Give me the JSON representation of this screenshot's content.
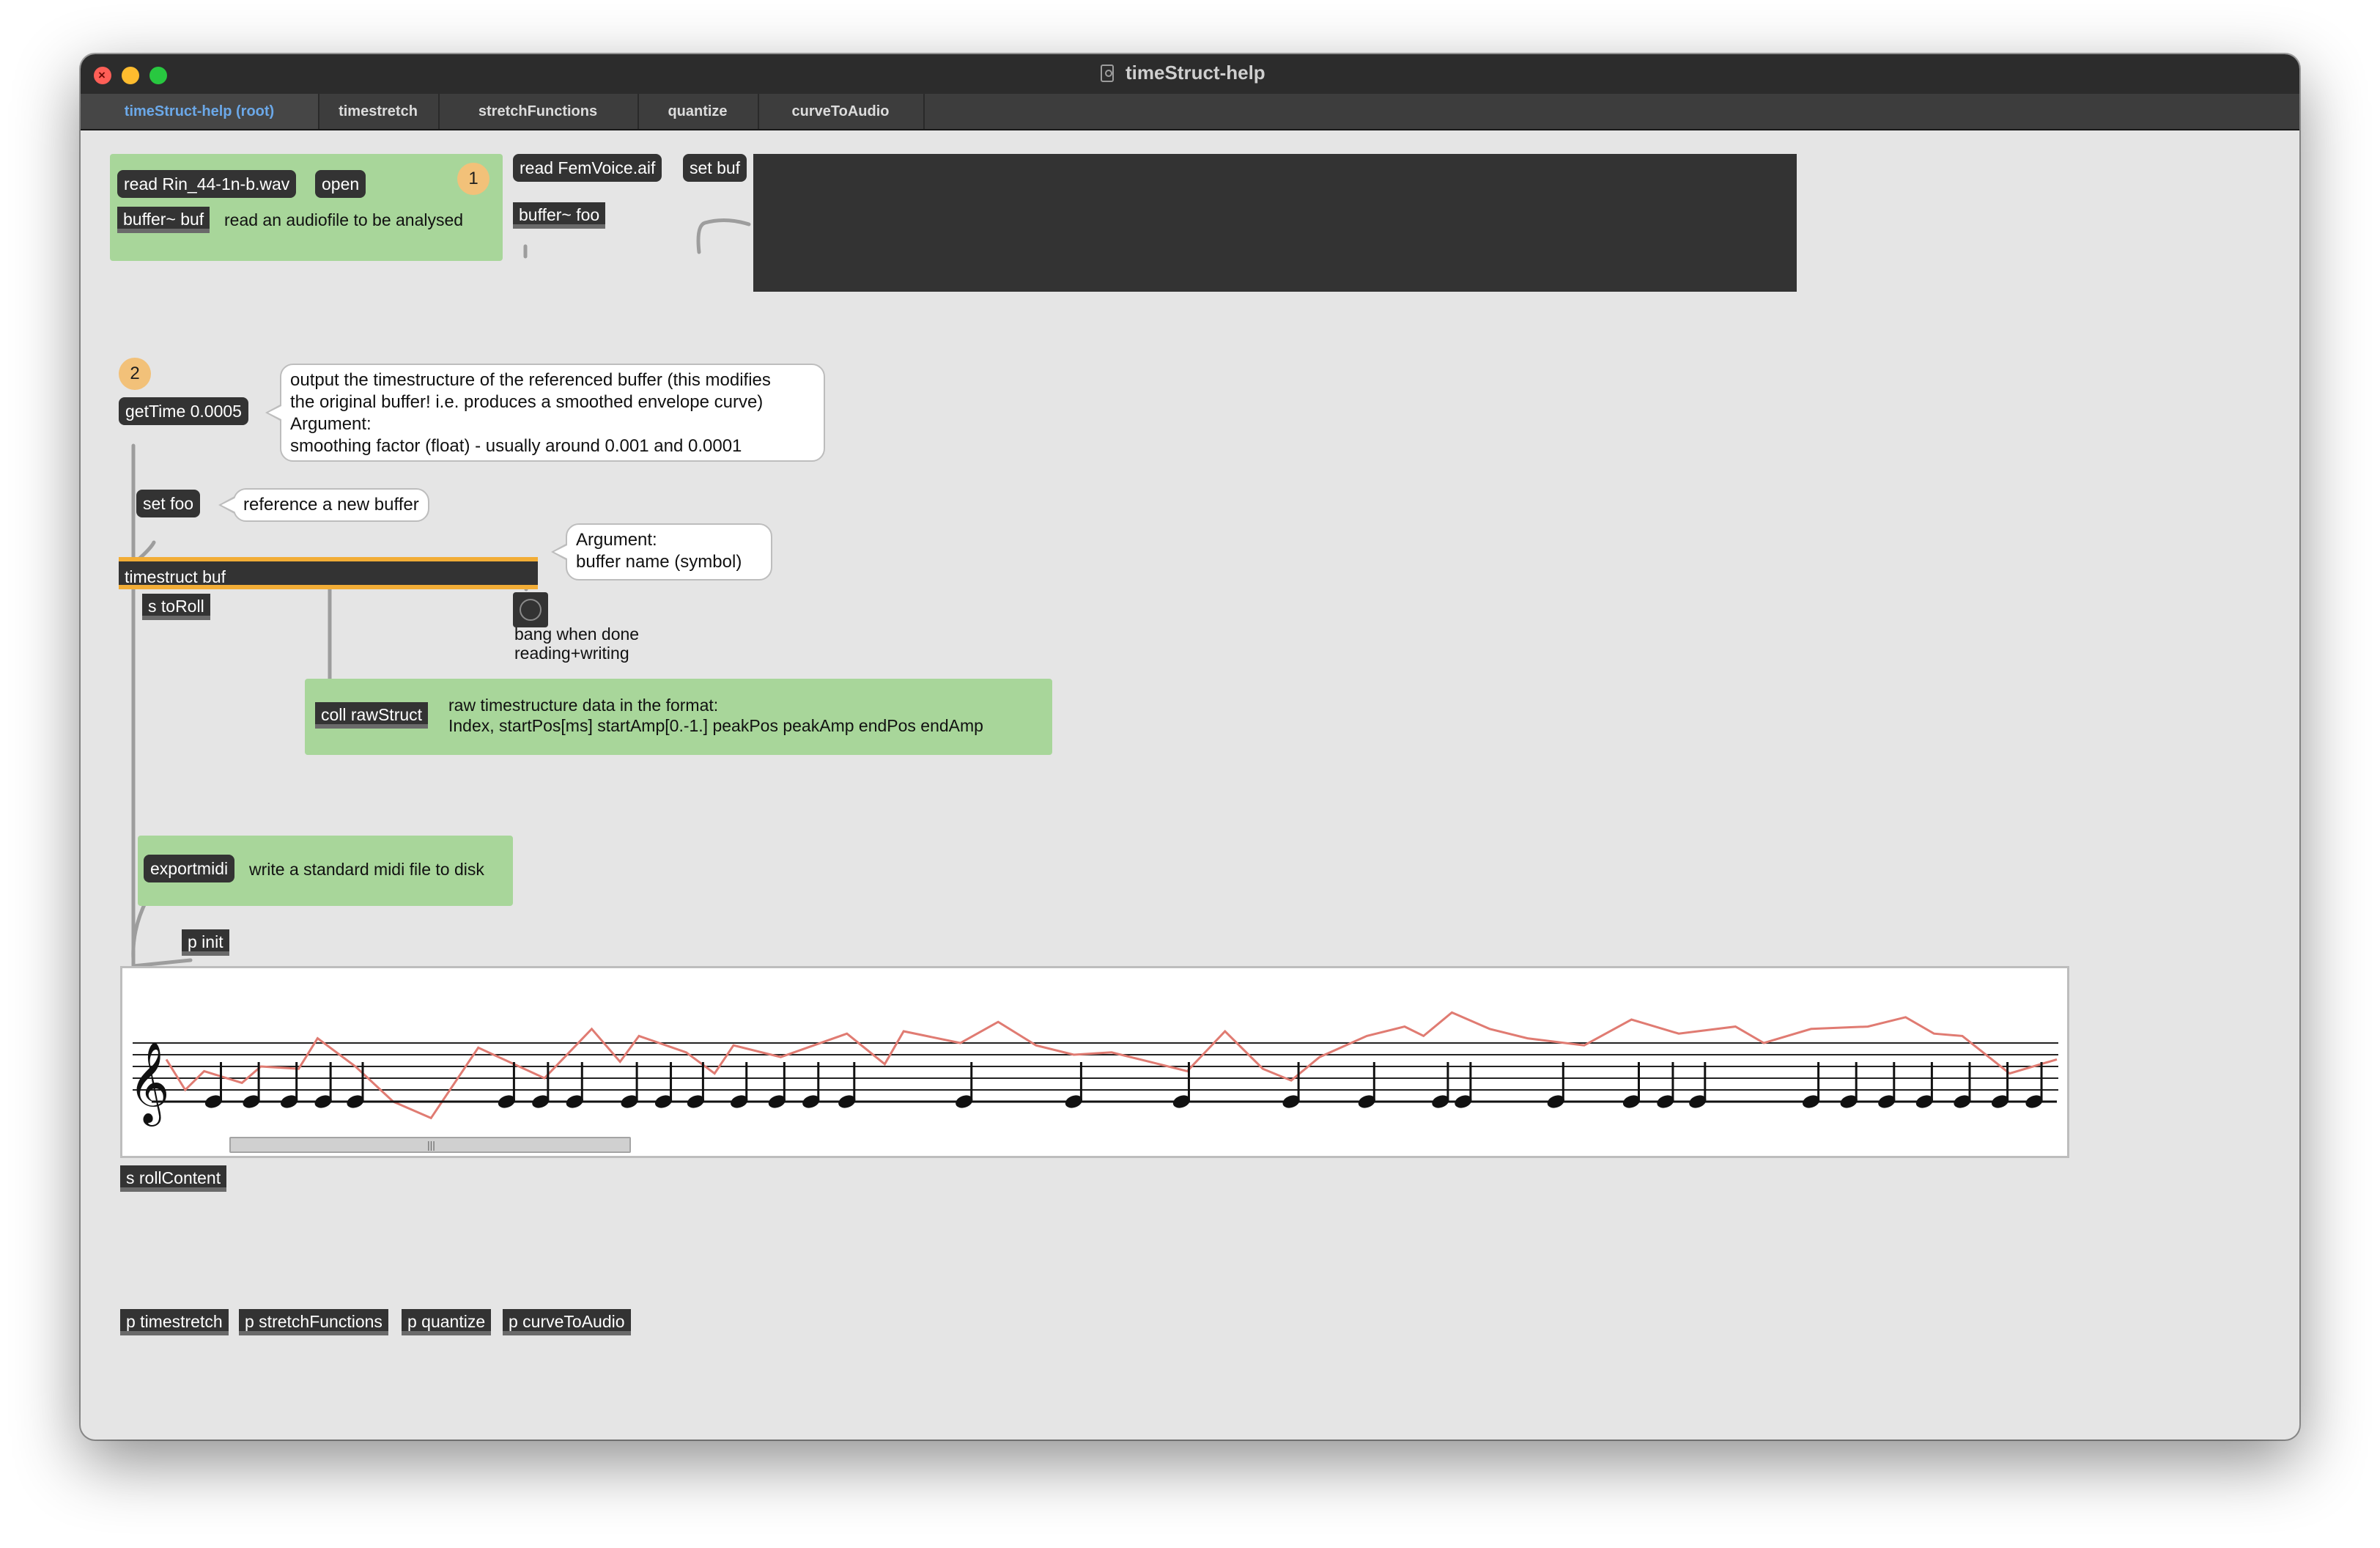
{
  "window": {
    "title": "timeStruct-help",
    "tabs": [
      {
        "label": "timeStruct-help (root)",
        "active": true
      },
      {
        "label": "timestretch",
        "active": false
      },
      {
        "label": "stretchFunctions",
        "active": false
      },
      {
        "label": "quantize",
        "active": false
      },
      {
        "label": "curveToAudio",
        "active": false
      }
    ]
  },
  "colors": {
    "panel_green": "#a8d69a",
    "object_dark": "#333333",
    "badge": "#f2c179",
    "active_tab": "#6ba8e8",
    "envelope": "#e07b72",
    "timestruct_border": "#f2ad36"
  },
  "section1": {
    "badge": "1",
    "read_msg": "read Rin_44-1n-b.wav",
    "open_msg": "open",
    "buffer_obj": "buffer~ buf",
    "comment": "read an audiofile to be analysed"
  },
  "section_foo": {
    "read_msg": "read FemVoice.aif",
    "setbuf_msg": "set buf",
    "buffer_obj": "buffer~ foo"
  },
  "section2": {
    "badge": "2",
    "gettime_msg": "getTime 0.0005",
    "gettime_comment": [
      "output the timestructure of the referenced buffer (this modifies",
      "the original buffer! i.e. produces a smoothed envelope curve)",
      "Argument:",
      "smoothing factor (float) - usually around 0.001 and 0.0001"
    ],
    "setfoo_msg": "set foo",
    "setfoo_comment": "reference a new buffer",
    "timestruct_obj": "timestruct buf",
    "arg_comment": [
      "Argument:",
      "buffer name (symbol)"
    ],
    "send_toroll": "s toRoll",
    "bang_comment": [
      "bang when done",
      "reading+writing"
    ],
    "coll_obj": "coll rawStruct",
    "coll_comment": [
      "raw timestructure data in the format:",
      "Index, startPos[ms] startAmp[0.-1.] peakPos peakAmp endPos endAmp"
    ],
    "exportmidi_msg": "exportmidi",
    "exportmidi_comment": "write a standard midi file to disk",
    "pinit_obj": "p init",
    "send_rollcontent": "s rollContent"
  },
  "roll": {
    "clef": "treble-clef-icon",
    "scroll_grip": "|||",
    "envelope": [
      [
        0,
        0.33
      ],
      [
        0.01,
        0.2
      ],
      [
        0.02,
        0.28
      ],
      [
        0.04,
        0.23
      ],
      [
        0.05,
        0.3
      ],
      [
        0.07,
        0.29
      ],
      [
        0.08,
        0.42
      ],
      [
        0.1,
        0.3
      ],
      [
        0.12,
        0.15
      ],
      [
        0.14,
        0.08
      ],
      [
        0.165,
        0.38
      ],
      [
        0.2,
        0.25
      ],
      [
        0.225,
        0.46
      ],
      [
        0.24,
        0.32
      ],
      [
        0.25,
        0.43
      ],
      [
        0.275,
        0.36
      ],
      [
        0.29,
        0.27
      ],
      [
        0.3,
        0.39
      ],
      [
        0.325,
        0.34
      ],
      [
        0.36,
        0.44
      ],
      [
        0.38,
        0.31
      ],
      [
        0.39,
        0.45
      ],
      [
        0.42,
        0.4
      ],
      [
        0.44,
        0.49
      ],
      [
        0.46,
        0.39
      ],
      [
        0.48,
        0.35
      ],
      [
        0.5,
        0.36
      ],
      [
        0.52,
        0.32
      ],
      [
        0.54,
        0.28
      ],
      [
        0.56,
        0.45
      ],
      [
        0.58,
        0.29
      ],
      [
        0.595,
        0.24
      ],
      [
        0.61,
        0.34
      ],
      [
        0.635,
        0.43
      ],
      [
        0.655,
        0.47
      ],
      [
        0.665,
        0.43
      ],
      [
        0.68,
        0.53
      ],
      [
        0.7,
        0.46
      ],
      [
        0.72,
        0.42
      ],
      [
        0.75,
        0.39
      ],
      [
        0.775,
        0.5
      ],
      [
        0.8,
        0.44
      ],
      [
        0.83,
        0.47
      ],
      [
        0.845,
        0.4
      ],
      [
        0.87,
        0.46
      ],
      [
        0.9,
        0.47
      ],
      [
        0.92,
        0.51
      ],
      [
        0.935,
        0.44
      ],
      [
        0.95,
        0.43
      ],
      [
        0.975,
        0.27
      ],
      [
        1,
        0.33
      ]
    ],
    "notes": [
      0.025,
      0.045,
      0.065,
      0.083,
      0.1,
      0.18,
      0.198,
      0.216,
      0.245,
      0.263,
      0.28,
      0.303,
      0.323,
      0.341,
      0.36,
      0.422,
      0.48,
      0.537,
      0.595,
      0.635,
      0.674,
      0.686,
      0.735,
      0.775,
      0.793,
      0.81,
      0.87,
      0.89,
      0.91,
      0.93,
      0.95,
      0.97,
      0.988
    ]
  },
  "footer": {
    "buttons": [
      "p timestretch",
      "p stretchFunctions",
      "p quantize",
      "p curveToAudio"
    ]
  }
}
